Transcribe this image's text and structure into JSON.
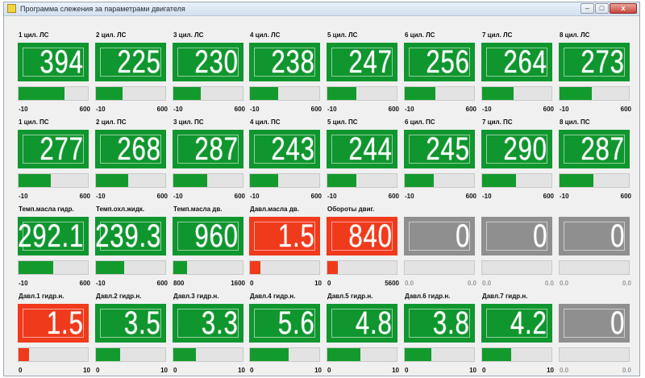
{
  "window": {
    "title": "Программа слежения за параметрами двигателя",
    "min_label": "–",
    "max_label": "□",
    "close_label": "x"
  },
  "colors": {
    "normal": "#0f962e",
    "alarm": "#f03a1c",
    "inactive": "#8f8f8f",
    "bar_fill": "#139a2d",
    "bar_fill_alarm": "#f03a1c"
  },
  "rows": [
    [
      {
        "label": "1 цил. ЛС",
        "value": "394",
        "min": "-10",
        "max": "600",
        "status": "normal",
        "level": 0.66
      },
      {
        "label": "2 цил. ЛС",
        "value": "225",
        "min": "-10",
        "max": "600",
        "status": "normal",
        "level": 0.38
      },
      {
        "label": "3 цил. ЛС",
        "value": "230",
        "min": "-10",
        "max": "600",
        "status": "normal",
        "level": 0.39
      },
      {
        "label": "4 цил. ЛС",
        "value": "238",
        "min": "-10",
        "max": "600",
        "status": "normal",
        "level": 0.41
      },
      {
        "label": "5 цил. ЛС",
        "value": "247",
        "min": "-10",
        "max": "600",
        "status": "normal",
        "level": 0.42
      },
      {
        "label": "6 цил. ЛС",
        "value": "256",
        "min": "-10",
        "max": "600",
        "status": "normal",
        "level": 0.44
      },
      {
        "label": "7 цил. ЛС",
        "value": "264",
        "min": "-10",
        "max": "600",
        "status": "normal",
        "level": 0.45
      },
      {
        "label": "8 цил. ЛС",
        "value": "273",
        "min": "-10",
        "max": "600",
        "status": "normal",
        "level": 0.46
      }
    ],
    [
      {
        "label": "1 цил. ПС",
        "value": "277",
        "min": "-10",
        "max": "600",
        "status": "normal",
        "level": 0.47
      },
      {
        "label": "2 цил. ПС",
        "value": "268",
        "min": "-10",
        "max": "600",
        "status": "normal",
        "level": 0.46
      },
      {
        "label": "3 цил. ПС",
        "value": "287",
        "min": "-10",
        "max": "600",
        "status": "normal",
        "level": 0.49
      },
      {
        "label": "4 цил. ПС",
        "value": "243",
        "min": "-10",
        "max": "600",
        "status": "normal",
        "level": 0.41
      },
      {
        "label": "5 цил. ПС",
        "value": "244",
        "min": "-10",
        "max": "600",
        "status": "normal",
        "level": 0.42
      },
      {
        "label": "6 цил. ПС",
        "value": "245",
        "min": "-10",
        "max": "600",
        "status": "normal",
        "level": 0.42
      },
      {
        "label": "7 цил. ПС",
        "value": "290",
        "min": "-10",
        "max": "600",
        "status": "normal",
        "level": 0.49
      },
      {
        "label": "8 цил. ПС",
        "value": "287",
        "min": "-10",
        "max": "600",
        "status": "normal",
        "level": 0.49
      }
    ],
    [
      {
        "label": "Темп.масла гидр.",
        "value": "292.1",
        "min": "-10",
        "max": "600",
        "status": "normal",
        "level": 0.5
      },
      {
        "label": "Темп.охл.жидк.",
        "value": "239.3",
        "min": "-10",
        "max": "600",
        "status": "normal",
        "level": 0.41
      },
      {
        "label": "Темп.масла дв.",
        "value": "960",
        "min": "800",
        "max": "1600",
        "status": "normal",
        "level": 0.2
      },
      {
        "label": "Давл.масла дв.",
        "value": "1.5",
        "min": "0",
        "max": "10",
        "status": "alarm",
        "level": 0.15
      },
      {
        "label": "Обороты двиг.",
        "value": "840",
        "min": "0",
        "max": "5600",
        "status": "alarm",
        "level": 0.15
      },
      {
        "label": "",
        "value": "0",
        "min": "0.0",
        "max": "0.0",
        "status": "inactive",
        "level": 0
      },
      {
        "label": "",
        "value": "0",
        "min": "0.0",
        "max": "0.0",
        "status": "inactive",
        "level": 0
      },
      {
        "label": "",
        "value": "0",
        "min": "0.0",
        "max": "0.0",
        "status": "inactive",
        "level": 0
      }
    ],
    [
      {
        "label": "Давл.1 гидр.н.",
        "value": "1.5",
        "min": "0",
        "max": "10",
        "status": "alarm",
        "level": 0.15
      },
      {
        "label": "Давл.2 гидр.н.",
        "value": "3.5",
        "min": "0",
        "max": "10",
        "status": "normal",
        "level": 0.35
      },
      {
        "label": "Давл.3 гидр.н.",
        "value": "3.3",
        "min": "0",
        "max": "10",
        "status": "normal",
        "level": 0.33
      },
      {
        "label": "Давл.4 гидр.н.",
        "value": "5.6",
        "min": "0",
        "max": "10",
        "status": "normal",
        "level": 0.56
      },
      {
        "label": "Давл.5 гидр.н.",
        "value": "4.8",
        "min": "0",
        "max": "10",
        "status": "normal",
        "level": 0.48
      },
      {
        "label": "Давл.6 гидр.н.",
        "value": "3.8",
        "min": "0",
        "max": "10",
        "status": "normal",
        "level": 0.38
      },
      {
        "label": "Давл.7 гидр.н.",
        "value": "4.2",
        "min": "0",
        "max": "10",
        "status": "normal",
        "level": 0.42
      },
      {
        "label": "",
        "value": "0",
        "min": "0.0",
        "max": "0.0",
        "status": "inactive",
        "level": 0
      }
    ]
  ]
}
